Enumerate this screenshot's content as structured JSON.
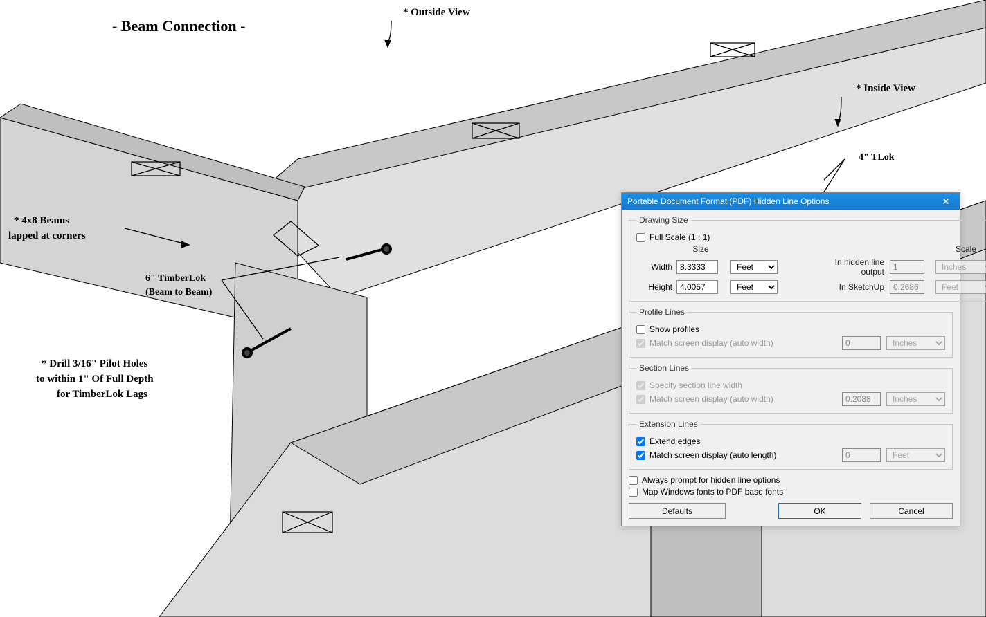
{
  "drawing": {
    "title": "- Beam Connection -",
    "outside_view": "* Outside View",
    "inside_view": "* Inside View",
    "tlok": "4\" TLok",
    "beams_lapped_1": "* 4x8 Beams",
    "beams_lapped_2": "lapped at corners",
    "timberlok_1": "6\" TimberLok",
    "timberlok_2": "(Beam to Beam)",
    "pilot_1": "* Drill 3/16\" Pilot Holes",
    "pilot_2": "to within 1\" Of Full Depth",
    "pilot_3": "for TimberLok Lags"
  },
  "dialog": {
    "title": "Portable Document Format (PDF) Hidden Line Options",
    "drawing_size": {
      "legend": "Drawing Size",
      "full_scale": "Full Scale (1 : 1)",
      "size_hdr": "Size",
      "scale_hdr": "Scale",
      "width_lbl": "Width",
      "width_val": "8.3333",
      "width_unit": "Feet",
      "height_lbl": "Height",
      "height_val": "4.0057",
      "height_unit": "Feet",
      "hidden_lbl": "In hidden line output",
      "hidden_val": "1",
      "hidden_unit": "Inches",
      "sketchup_lbl": "In SketchUp",
      "sketchup_val": "0.2686",
      "sketchup_unit": "Feet"
    },
    "profile": {
      "legend": "Profile Lines",
      "show": "Show profiles",
      "match": "Match screen display (auto width)",
      "val": "0",
      "unit": "Inches"
    },
    "section": {
      "legend": "Section Lines",
      "specify": "Specify section line width",
      "match": "Match screen display (auto width)",
      "val": "0.2088",
      "unit": "Inches"
    },
    "extension": {
      "legend": "Extension Lines",
      "extend": "Extend edges",
      "match": "Match screen display (auto length)",
      "val": "0",
      "unit": "Feet"
    },
    "always_prompt": "Always prompt for hidden line options",
    "map_fonts": "Map Windows fonts to PDF base fonts",
    "defaults": "Defaults",
    "ok": "OK",
    "cancel": "Cancel"
  }
}
